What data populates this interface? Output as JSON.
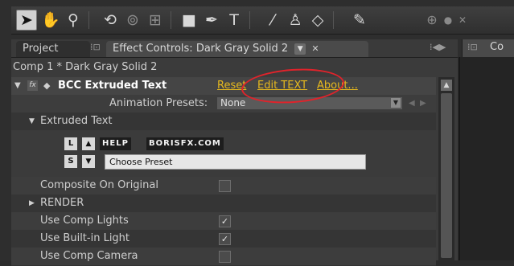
{
  "tabs": {
    "project": "Project",
    "effect_controls": "Effect Controls: Dark Gray Solid 2",
    "right_panel": "Co"
  },
  "comp_line": "Comp 1 * Dark Gray Solid 2",
  "effect": {
    "name": "BCC Extruded Text",
    "links": [
      "Reset",
      "Edit TEXT",
      "About..."
    ],
    "animation_presets_label": "Animation Presets:",
    "animation_presets_value": "None",
    "group_header": "Extruded Text"
  },
  "bcc_ui": {
    "key_l": "L",
    "key_s": "S",
    "help": "HELP",
    "site": "BORISFX.COM",
    "choose_preset": "Choose Preset"
  },
  "properties": [
    {
      "label": "Composite On Original",
      "checked": false
    },
    {
      "label": "RENDER"
    },
    {
      "label": "Use Comp Lights",
      "checked": true
    },
    {
      "label": "Use Built-in Light",
      "checked": true
    },
    {
      "label": "Use Comp Camera",
      "checked": false
    }
  ],
  "icons": {
    "toolbar": [
      "selection-arrow-icon",
      "hand-icon",
      "zoom-icon",
      "rotate-icon",
      "orbit-camera-icon",
      "pan-behind-icon",
      "rectangle-mask-icon",
      "pen-icon",
      "type-icon",
      "brush-icon",
      "clone-stamp-icon",
      "eraser-icon",
      "puppet-pin-icon",
      "axis-icon"
    ]
  },
  "colors": {
    "link": "#e7b91e",
    "highlight_ellipse": "#e0232b",
    "panel_bg": "#3b3b3b"
  }
}
